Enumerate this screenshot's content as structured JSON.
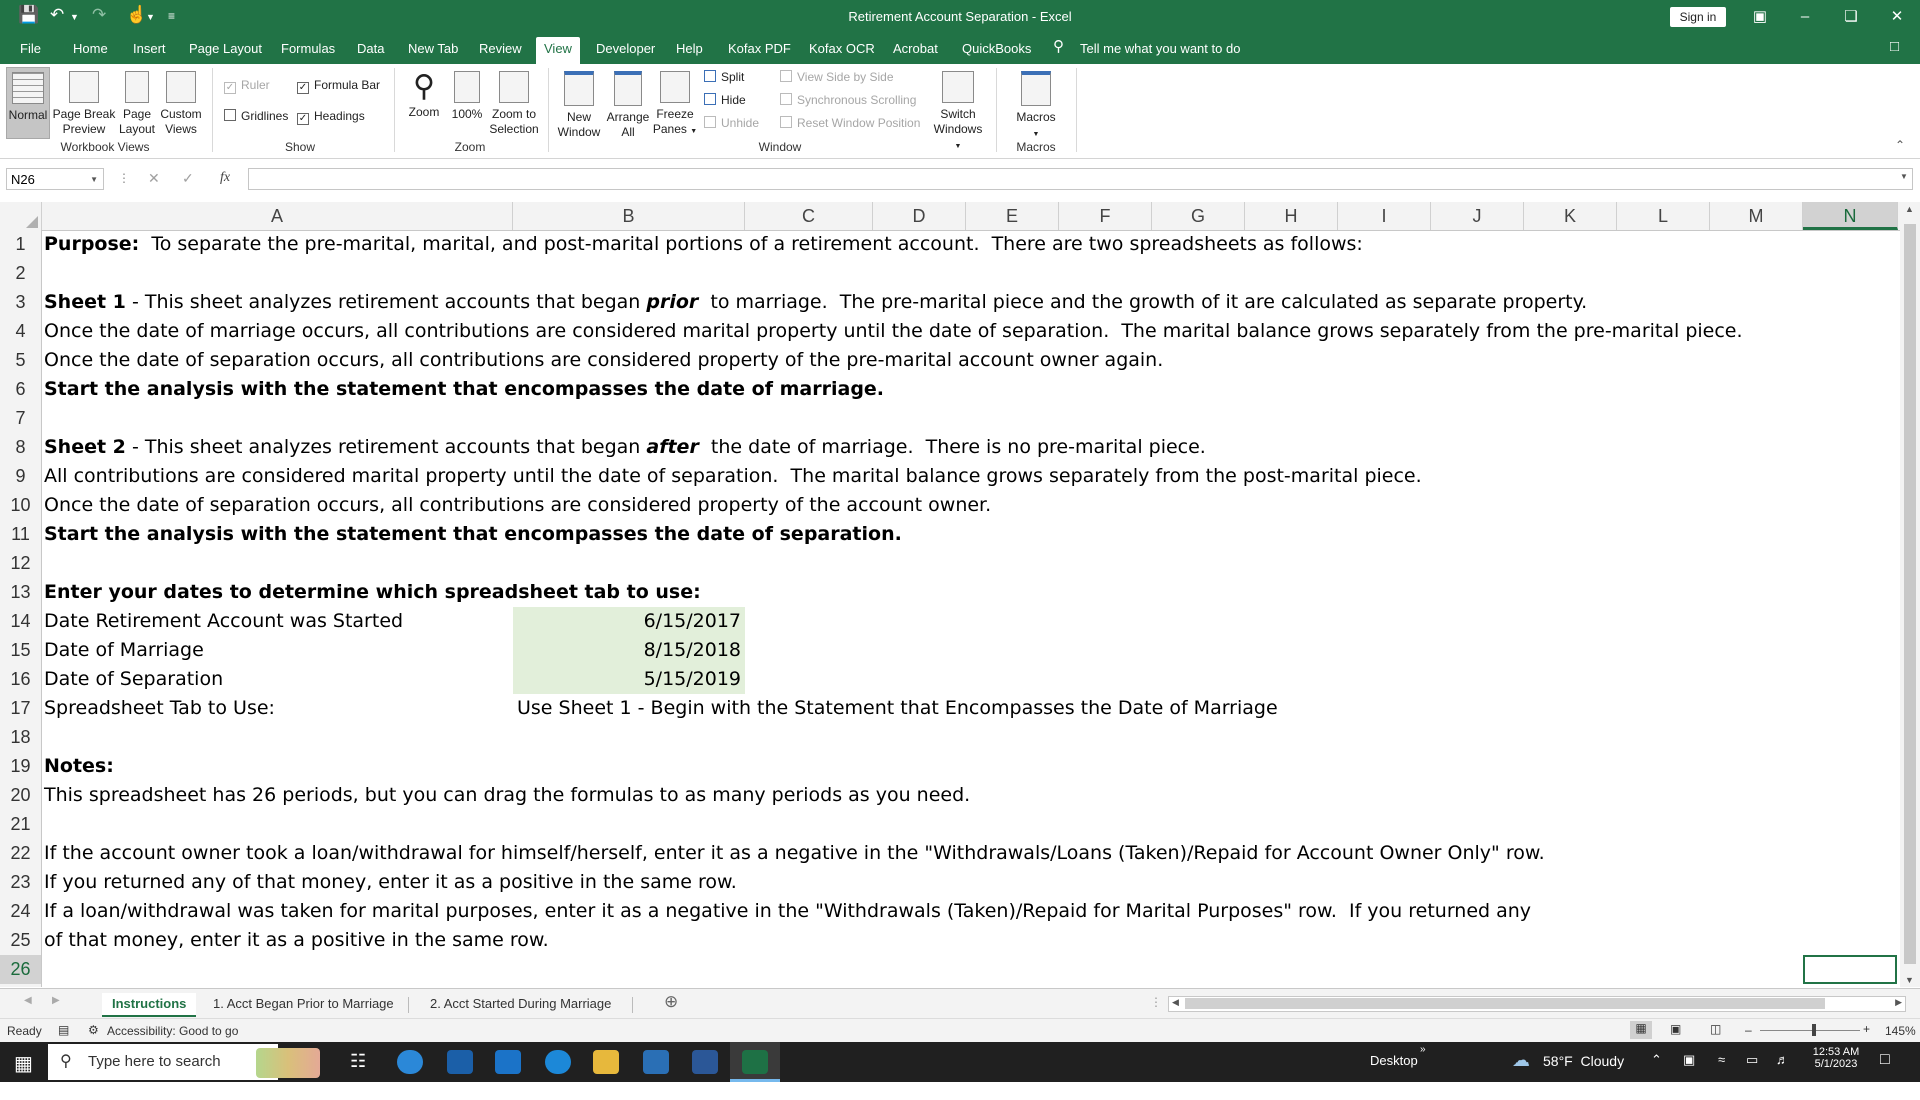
{
  "window": {
    "title": "Retirement Account Separation  -  Excel",
    "sign_in": "Sign in"
  },
  "ribbon_tabs": [
    "File",
    "Home",
    "Insert",
    "Page Layout",
    "Formulas",
    "Data",
    "New Tab",
    "Review",
    "View",
    "Developer",
    "Help",
    "Kofax PDF",
    "Kofax OCR",
    "Acrobat",
    "QuickBooks"
  ],
  "active_tab": "View",
  "tell_me": "Tell me what you want to do",
  "ribbon": {
    "workbook_views": {
      "label": "Workbook Views",
      "normal": "Normal",
      "page_break_1": "Page Break",
      "page_break_2": "Preview",
      "page_layout_1": "Page",
      "page_layout_2": "Layout",
      "custom_views_1": "Custom",
      "custom_views_2": "Views"
    },
    "show": {
      "label": "Show",
      "ruler": "Ruler",
      "formula_bar": "Formula Bar",
      "gridlines": "Gridlines",
      "headings": "Headings"
    },
    "zoom": {
      "label": "Zoom",
      "zoom": "Zoom",
      "hundred": "100%",
      "zoom_sel_1": "Zoom to",
      "zoom_sel_2": "Selection"
    },
    "window": {
      "label": "Window",
      "new_window_1": "New",
      "new_window_2": "Window",
      "arrange_1": "Arrange",
      "arrange_2": "All",
      "freeze_1": "Freeze",
      "freeze_2": "Panes",
      "split": "Split",
      "hide": "Hide",
      "unhide": "Unhide",
      "side_by_side": "View Side by Side",
      "sync_scroll": "Synchronous Scrolling",
      "reset_pos": "Reset Window Position",
      "switch_1": "Switch",
      "switch_2": "Windows"
    },
    "macros": {
      "label": "Macros",
      "macros": "Macros"
    }
  },
  "formula_bar": {
    "name_box": "N26",
    "fx": "fx",
    "formula": ""
  },
  "columns": [
    "A",
    "B",
    "C",
    "D",
    "E",
    "F",
    "G",
    "H",
    "I",
    "J",
    "K",
    "L",
    "M",
    "N"
  ],
  "selected_column": "N",
  "selected_row": "26",
  "rows": [
    {
      "n": "1",
      "parts": [
        {
          "t": "Purpose:",
          "s": "b"
        },
        {
          "t": "  To separate the pre-marital, marital, and post-marital portions of a retirement account.  There are two spreadsheets as follows:",
          "s": ""
        }
      ]
    },
    {
      "n": "2",
      "parts": []
    },
    {
      "n": "3",
      "parts": [
        {
          "t": "Sheet 1",
          "s": "b"
        },
        {
          "t": " - This sheet analyzes retirement accounts that began ",
          "s": ""
        },
        {
          "t": "prior",
          "s": "bi"
        },
        {
          "t": "  to marriage.  The pre-marital piece and the growth of it are calculated as separate property.",
          "s": ""
        }
      ]
    },
    {
      "n": "4",
      "parts": [
        {
          "t": "Once the date of marriage occurs, all contributions are considered marital property until the date of separation.  The marital balance grows separately from the pre-marital piece.",
          "s": ""
        }
      ]
    },
    {
      "n": "5",
      "parts": [
        {
          "t": "Once the date of separation occurs, all contributions are considered property of the pre-marital account owner again.",
          "s": ""
        }
      ]
    },
    {
      "n": "6",
      "parts": [
        {
          "t": "Start the analysis with the statement that encompasses the date of marriage.",
          "s": "b"
        }
      ]
    },
    {
      "n": "7",
      "parts": []
    },
    {
      "n": "8",
      "parts": [
        {
          "t": "Sheet 2",
          "s": "b"
        },
        {
          "t": " - This sheet analyzes retirement accounts that began ",
          "s": ""
        },
        {
          "t": "after",
          "s": "bi"
        },
        {
          "t": "  the date of marriage.  There is no pre-marital piece.",
          "s": ""
        }
      ]
    },
    {
      "n": "9",
      "parts": [
        {
          "t": "All contributions are considered marital property until the date of separation.  The marital balance grows separately from the post-marital piece.",
          "s": ""
        }
      ]
    },
    {
      "n": "10",
      "parts": [
        {
          "t": "Once the date of separation occurs, all contributions are considered property of the account owner.",
          "s": ""
        }
      ]
    },
    {
      "n": "11",
      "parts": [
        {
          "t": "Start the analysis with the statement that encompasses the date of separation.",
          "s": "b"
        }
      ]
    },
    {
      "n": "12",
      "parts": []
    },
    {
      "n": "13",
      "parts": [
        {
          "t": "Enter your dates to determine which spreadsheet tab to use:",
          "s": "b"
        }
      ]
    },
    {
      "n": "14",
      "parts": [
        {
          "t": "Date Retirement Account was Started",
          "s": ""
        }
      ],
      "date": "6/15/2017"
    },
    {
      "n": "15",
      "parts": [
        {
          "t": "Date of Marriage",
          "s": ""
        }
      ],
      "date": "8/15/2018"
    },
    {
      "n": "16",
      "parts": [
        {
          "t": "Date of Separation",
          "s": ""
        }
      ],
      "date": "5/15/2019"
    },
    {
      "n": "17",
      "parts": [
        {
          "t": "Spreadsheet Tab to Use:",
          "s": ""
        }
      ],
      "b_text": "Use Sheet 1 - Begin with the Statement that Encompasses the Date of Marriage"
    },
    {
      "n": "18",
      "parts": []
    },
    {
      "n": "19",
      "parts": [
        {
          "t": "Notes:",
          "s": "b"
        }
      ]
    },
    {
      "n": "20",
      "parts": [
        {
          "t": "This spreadsheet has 26 periods, but you can drag the formulas to as many periods as you need.",
          "s": ""
        }
      ]
    },
    {
      "n": "21",
      "parts": []
    },
    {
      "n": "22",
      "parts": [
        {
          "t": "If the account owner took a loan/withdrawal for himself/herself, enter it as a negative in the \"Withdrawals/Loans (Taken)/Repaid for Account Owner Only\" row.",
          "s": ""
        }
      ]
    },
    {
      "n": "23",
      "parts": [
        {
          "t": "If you returned any of that money, enter it as a positive in the same row.",
          "s": ""
        }
      ]
    },
    {
      "n": "24",
      "parts": [
        {
          "t": "If a loan/withdrawal was taken for marital purposes, enter it as a negative in the \"Withdrawals (Taken)/Repaid for Marital Purposes\" row.  If you returned any",
          "s": ""
        }
      ]
    },
    {
      "n": "25",
      "parts": [
        {
          "t": "of that money, enter it as a positive in the same row.",
          "s": ""
        }
      ]
    },
    {
      "n": "26",
      "parts": []
    }
  ],
  "sheet_tabs": [
    "Instructions",
    "1. Acct Began Prior to Marriage",
    "2. Acct Started During Marriage"
  ],
  "active_sheet": "Instructions",
  "status": {
    "ready": "Ready",
    "accessibility": "Accessibility: Good to go",
    "zoom": "145%"
  },
  "taskbar": {
    "search_placeholder": "Type here to search",
    "desktop": "Desktop",
    "weather": "58°F  Cloudy",
    "time": "12:53 AM",
    "date": "5/1/2023"
  },
  "colors": {
    "excel_green": "#217346",
    "input_fill": "#e2efda"
  }
}
